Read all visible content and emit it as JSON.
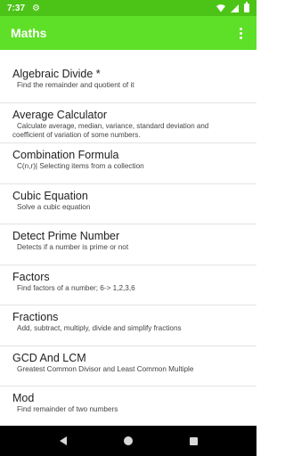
{
  "status": {
    "time": "7:37",
    "gear_icon": "gear-icon",
    "colors": {
      "status_bar": "#4cc417"
    }
  },
  "app_bar": {
    "title": "Maths",
    "overflow_icon": "more-vert-icon",
    "color": "#5ee028"
  },
  "items": [
    {
      "name": "Algebraic Divide *",
      "desc": "Find the remainder and quotient of it"
    },
    {
      "name": "Average Calculator",
      "desc": "Calculate average, median, variance, standard deviation and coefficient of variation of some numbers."
    },
    {
      "name": "Combination Formula",
      "desc": "C(n,r)| Selecting items from a collection"
    },
    {
      "name": "Cubic Equation",
      "desc": "Solve a cubic equation"
    },
    {
      "name": "Detect Prime Number",
      "desc": "Detects if a number is prime or not"
    },
    {
      "name": "Factors",
      "desc": "Find factors of a number; 6-> 1,2,3,6"
    },
    {
      "name": "Fractions",
      "desc": "Add, subtract, multiply, divide and simplify fractions"
    },
    {
      "name": "GCD And LCM",
      "desc": "Greatest Common Divisor and Least Common Multiple"
    },
    {
      "name": "Mod",
      "desc": "Find remainder of two numbers"
    }
  ],
  "nav": {
    "back_icon": "back-icon",
    "home_icon": "home-icon",
    "recents_icon": "recents-icon"
  }
}
